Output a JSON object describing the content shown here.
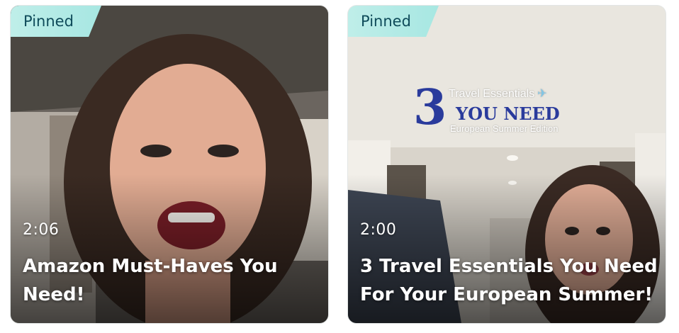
{
  "cards": [
    {
      "pinned_label": "Pinned",
      "duration": "2:06",
      "title": "Amazon Must-Haves You Need!"
    },
    {
      "pinned_label": "Pinned",
      "duration": "2:00",
      "title": "3 Travel Essentials You Need For Your European Summer!",
      "overlay": {
        "number": "3",
        "line1": "Travel Essentials",
        "line2": "YOU NEED",
        "line3": "European Summer Edition",
        "line1_icon": "airplane-icon"
      }
    }
  ],
  "colors": {
    "pinned_badge": "#a7e7e2",
    "pinned_text": "#0f4b5a",
    "overlay_blue": "#2a3b9c"
  }
}
